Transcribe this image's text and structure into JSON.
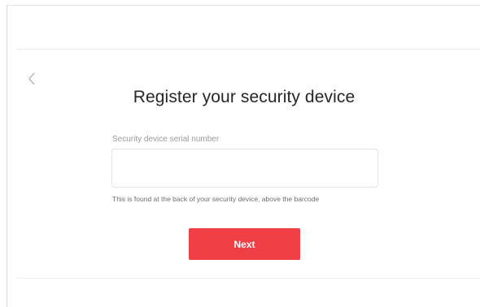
{
  "page": {
    "title": "Register your security device"
  },
  "form": {
    "serial_label": "Security device serial number",
    "serial_value": "",
    "serial_placeholder": "",
    "helper_text": "This is found at the back of your security device, above the barcode",
    "next_label": "Next"
  },
  "icons": {
    "back": "chevron-left-icon"
  },
  "colors": {
    "accent": "#f13f46",
    "title_text": "#262626",
    "label_text": "#9a9a9a"
  }
}
